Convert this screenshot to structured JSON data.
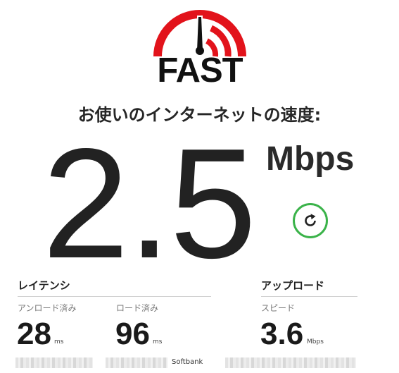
{
  "logo": {
    "word": "FAST",
    "icon": "speedometer-gauge-icon",
    "colors": {
      "arc": "#e2131b",
      "needle": "#111111"
    }
  },
  "headline": "お使いのインターネットの速度:",
  "speed": {
    "value": "2.5",
    "unit": "Mbps"
  },
  "refresh": {
    "icon": "refresh-icon",
    "color": "#3bb34a"
  },
  "latency": {
    "title": "レイテンシ",
    "unloaded": {
      "label": "アンロード済み",
      "value": "28",
      "unit": "ms"
    },
    "loaded": {
      "label": "ロード済み",
      "value": "96",
      "unit": "ms"
    }
  },
  "upload": {
    "title": "アップロード",
    "label": "スピード",
    "value": "3.6",
    "unit": "Mbps"
  },
  "footer": {
    "provider": "Softbank"
  }
}
